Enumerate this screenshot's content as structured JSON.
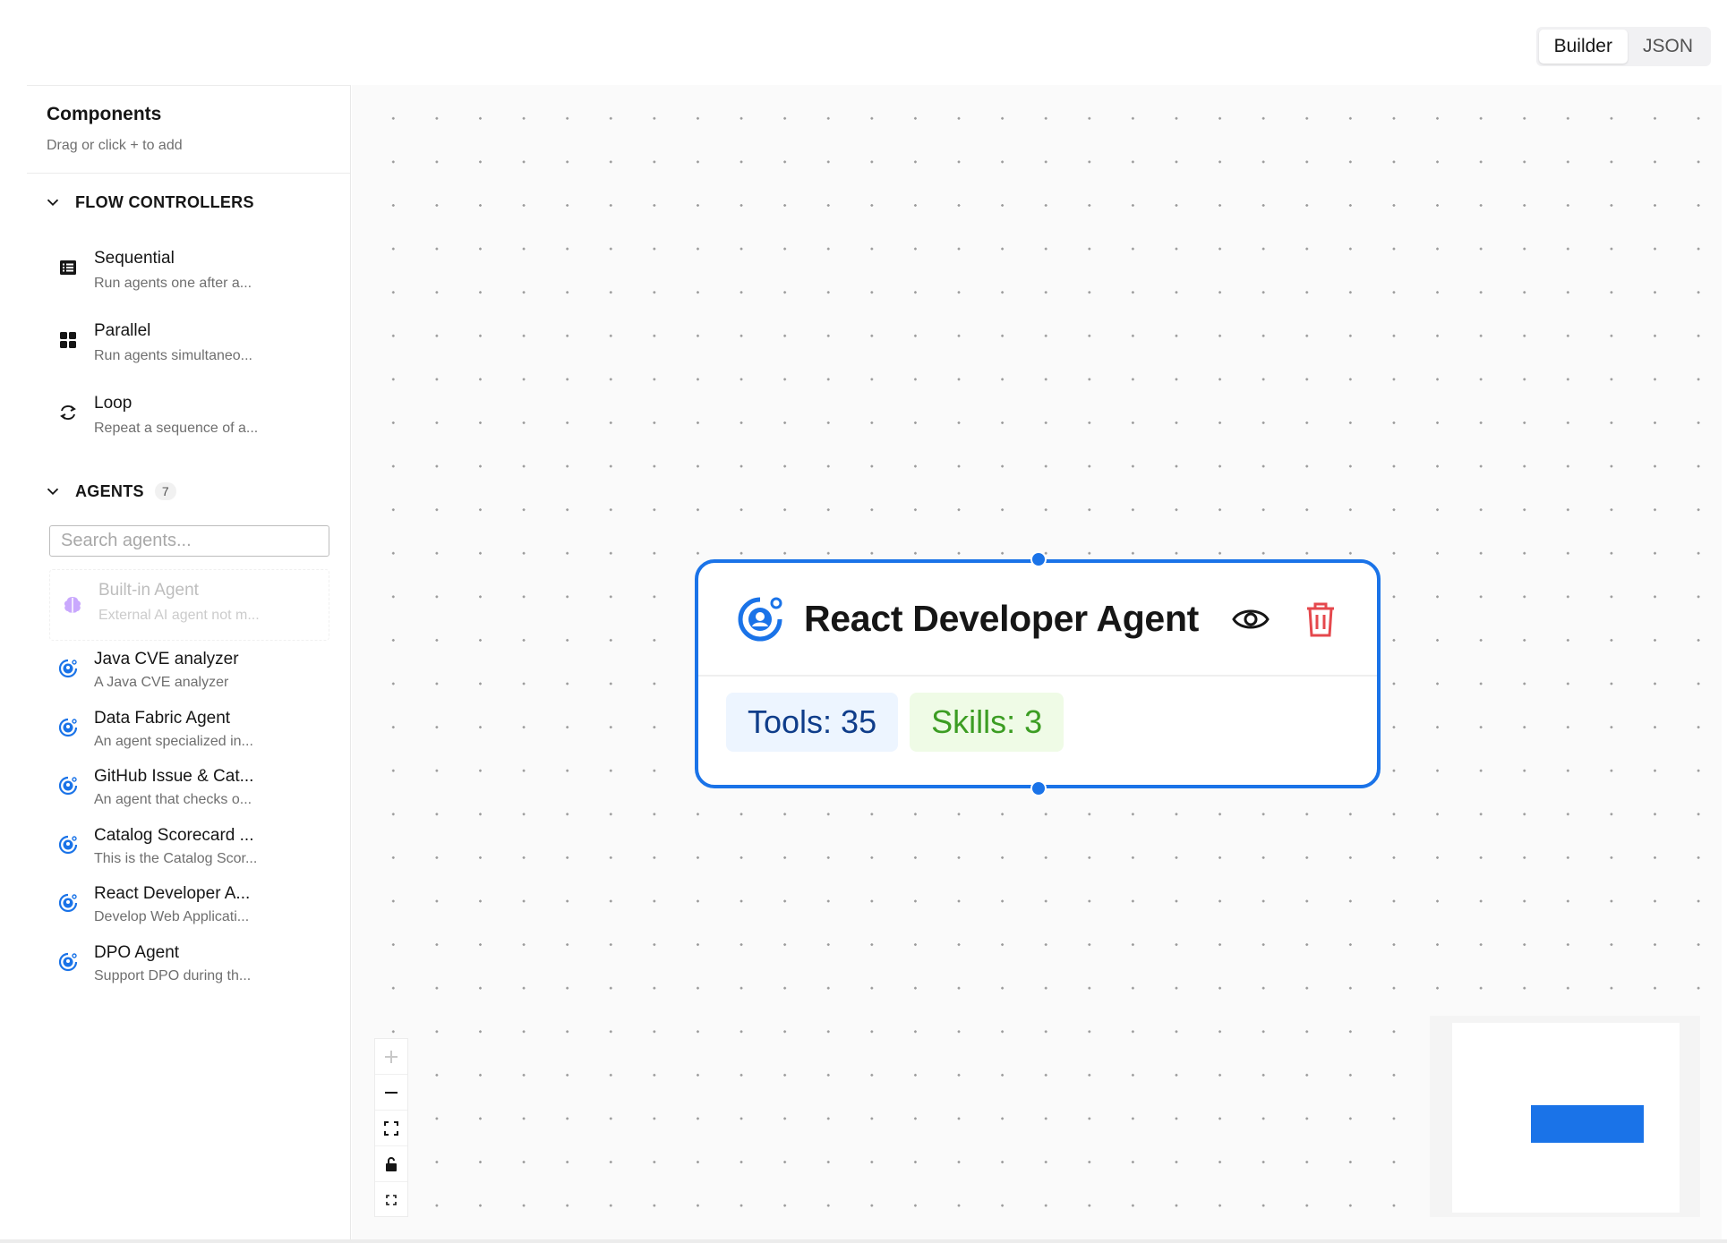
{
  "header": {
    "tabs": [
      {
        "label": "Builder",
        "active": true
      },
      {
        "label": "JSON",
        "active": false
      }
    ]
  },
  "sidebar": {
    "title": "Components",
    "subtitle": "Drag or click + to add",
    "flow_section": {
      "title": "FLOW CONTROLLERS",
      "items": [
        {
          "label": "Sequential",
          "desc": "Run agents one after a...",
          "icon": "list-icon"
        },
        {
          "label": "Parallel",
          "desc": "Run agents simultaneo...",
          "icon": "grid-icon"
        },
        {
          "label": "Loop",
          "desc": "Repeat a sequence of a...",
          "icon": "loop-icon"
        }
      ]
    },
    "agents_section": {
      "title": "AGENTS",
      "count": "7",
      "search_placeholder": "Search agents...",
      "builtin": {
        "label": "Built-in Agent",
        "desc": "External AI agent not m...",
        "icon": "brain-icon"
      },
      "items": [
        {
          "label": "Java CVE analyzer",
          "desc": "A Java CVE analyzer"
        },
        {
          "label": "Data Fabric Agent",
          "desc": "An agent specialized in..."
        },
        {
          "label": "GitHub Issue & Cat...",
          "desc": "An agent that checks o..."
        },
        {
          "label": "Catalog Scorecard ...",
          "desc": "This is the Catalog Scor..."
        },
        {
          "label": "React Developer A...",
          "desc": "Develop Web Applicati..."
        },
        {
          "label": "DPO Agent",
          "desc": "Support DPO during th..."
        }
      ]
    }
  },
  "canvas": {
    "node": {
      "title": "React Developer Agent",
      "tools": "Tools: 35",
      "skills": "Skills: 3",
      "icon": "agent-icon"
    },
    "controls": [
      "zoom-in-icon",
      "zoom-out-icon",
      "fit-view-icon",
      "lock-icon",
      "fullscreen-icon"
    ]
  },
  "colors": {
    "accent": "#1a73e8",
    "danger": "#e5484d",
    "tools_bg": "#edf5ff",
    "skills_text": "#3c9d23"
  }
}
